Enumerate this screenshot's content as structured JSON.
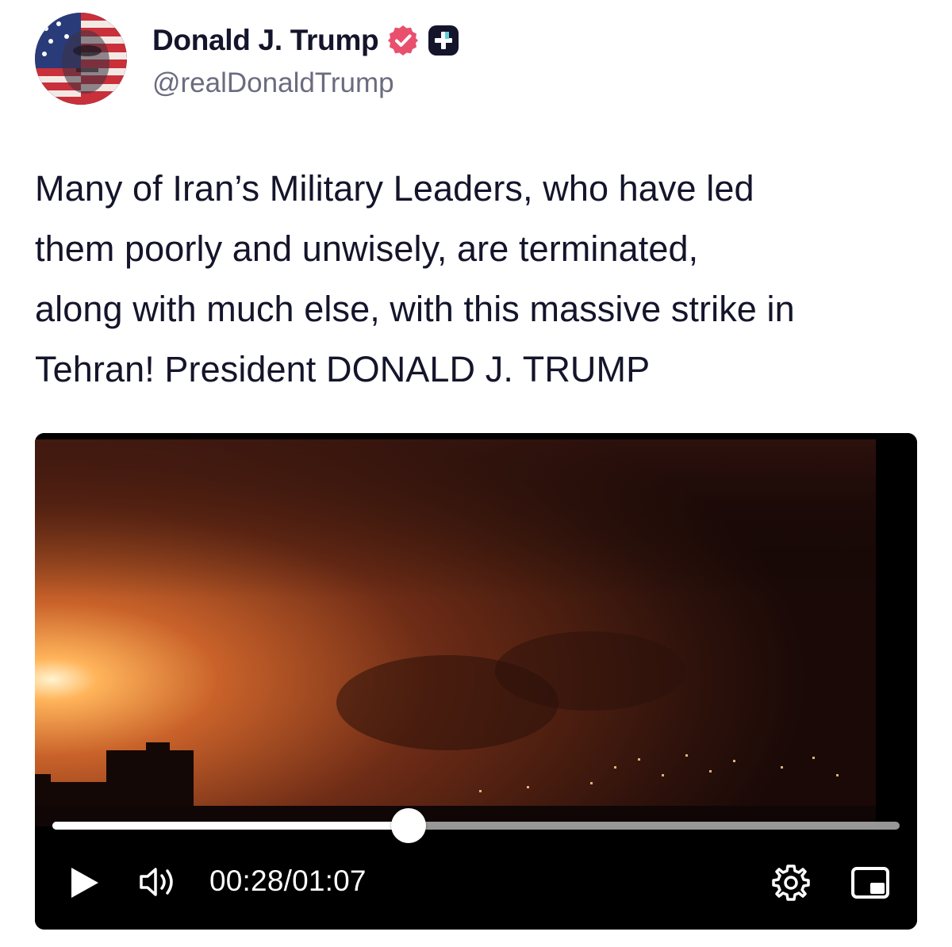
{
  "author": {
    "display_name": "Donald J. Trump",
    "handle": "@realDonaldTrump",
    "verified_badge_color": "#e8506e",
    "plus_badge_color": "#14142b"
  },
  "post": {
    "text": "Many of Iran’s Military Leaders, who have led\nthem poorly and unwisely, are terminated,\nalong with much else, with this massive strike in\nTehran! President DONALD J. TRUMP"
  },
  "video": {
    "current_time": "00:28",
    "separator": "/",
    "duration": "01:07",
    "progress_fraction": 0.42,
    "icons": [
      "play-icon",
      "volume-icon",
      "settings-icon",
      "picture-in-picture-icon"
    ]
  }
}
